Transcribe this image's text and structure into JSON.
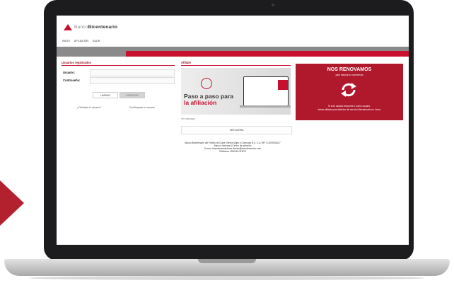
{
  "brand": {
    "prefix": "Banco",
    "name": "Bicentenario"
  },
  "nav": [
    "INICIO",
    "AFILIACIÓN",
    "SALIR"
  ],
  "login": {
    "title": "Usuarios registrados",
    "user_label": "Usuario:",
    "password_label": "Contraseña:",
    "clear_button": "LIMPIAR",
    "enter_button": "INGRESAR",
    "forgot_link": "¿Olvidaste tu usuario?",
    "unlock_link": "Desbloquear mi usuario"
  },
  "afiliate": {
    "title": "Afíliate",
    "banner_line1": "Paso a paso para",
    "banner_line2": "la afiliación",
    "caption": "Ver más aquí",
    "button": "VER AHORA"
  },
  "renewal": {
    "title": "NOS RENOVAMOS",
    "subtitle": "para mejorar tu experiencia",
    "text1": "Si eres usuario frecuente o nuevo usuario,",
    "text2": "debes afiliarte para disfrutar del servicio Bicentenario en Línea."
  },
  "footer": [
    "Banco Bicentenario del Pueblo de Clase Obrera Mujer y Comunas B.U. C.A. RIF G-20009148-7",
    "Banco Universal | Centro de atención",
    "Correo: bicentenarioenlinea.cliente@bicentenariobu.com",
    "Teléfonos: 0500 BI-CENTE"
  ]
}
